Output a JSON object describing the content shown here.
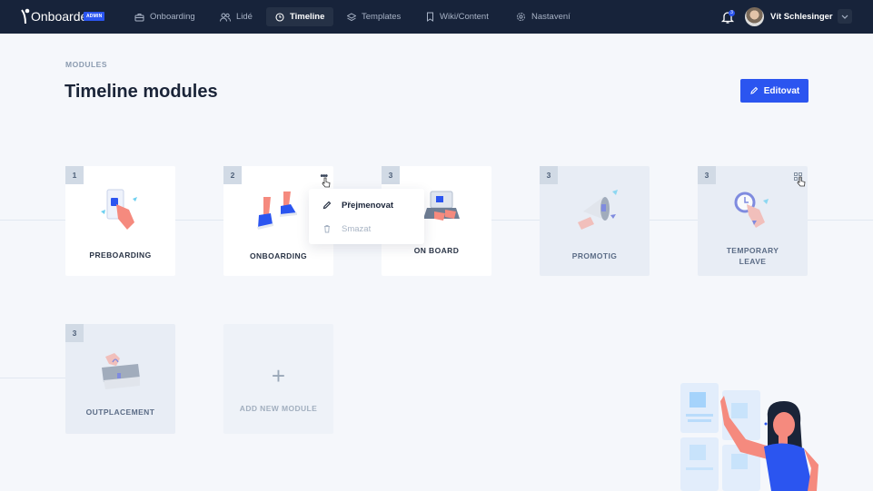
{
  "app": {
    "name": "Onboardee",
    "badge": "ADMIN"
  },
  "nav": {
    "items": [
      {
        "label": "Onboarding",
        "icon": "briefcase-icon",
        "active": false
      },
      {
        "label": "Lidé",
        "icon": "users-icon",
        "active": false
      },
      {
        "label": "Timeline",
        "icon": "clock-icon",
        "active": true
      },
      {
        "label": "Templates",
        "icon": "layers-icon",
        "active": false
      },
      {
        "label": "Wiki/Content",
        "icon": "bookmark-icon",
        "active": false
      },
      {
        "label": "Nastavení",
        "icon": "gear-icon",
        "active": false
      }
    ]
  },
  "user": {
    "name": "Vít Schlesinger",
    "notifications": "3"
  },
  "page": {
    "breadcrumb": "MODULES",
    "title": "Timeline modules",
    "edit_label": "Editovat"
  },
  "modules": [
    {
      "number": "1",
      "name": "PREBOARDING",
      "state": "active"
    },
    {
      "number": "2",
      "name": "ONBOARDING",
      "state": "active"
    },
    {
      "number": "3",
      "name": "ON BOARD",
      "state": "active"
    },
    {
      "number": "3",
      "name": "PROMOTIG",
      "state": "muted"
    },
    {
      "number": "3",
      "name_line1": "TEMPORARY",
      "name_line2": "LEAVE",
      "state": "muted"
    },
    {
      "number": "3",
      "name": "OUTPLACEMENT",
      "state": "muted"
    }
  ],
  "add_module": {
    "plus": "+",
    "label": "ADD NEW MODULE"
  },
  "context_menu": {
    "rename": "Přejmenovat",
    "delete": "Smazat"
  },
  "colors": {
    "nav_bg": "#17233a",
    "accent": "#2b55f0",
    "page_bg": "#f5f7fb"
  }
}
